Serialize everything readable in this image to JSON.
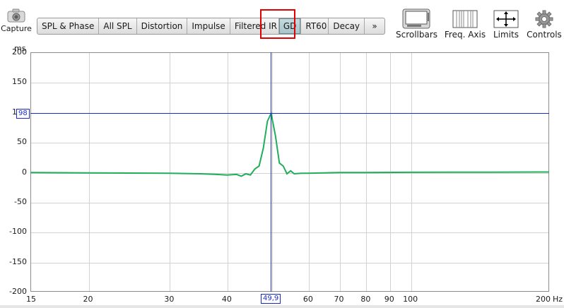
{
  "toolbar": {
    "capture_label": "Capture",
    "tabs": [
      "SPL & Phase",
      "All SPL",
      "Distortion",
      "Impulse",
      "Filtered IR",
      "GD",
      "RT60",
      "Decay"
    ],
    "more_label": "»",
    "active_tab": "GD",
    "right_tools": [
      "Scrollbars",
      "Freq. Axis",
      "Limits",
      "Controls"
    ]
  },
  "plot": {
    "y_unit": "ms",
    "x_unit": "Hz",
    "y_ticks": [
      "200",
      "150",
      "100",
      "50",
      "0",
      "-50",
      "-100",
      "-150",
      "-200"
    ],
    "x_ticks": [
      "15",
      "20",
      "30",
      "40",
      "50",
      "60",
      "70",
      "80",
      "90",
      "100",
      "200"
    ],
    "cursor_x_value": "49,9",
    "cursor_y_value": "98",
    "colors": {
      "trace": "#1fae5a",
      "cursor": "#1a2cc8",
      "highlight": "#e00000"
    }
  },
  "chart_data": {
    "type": "line",
    "x_scale": "log",
    "xlim": [
      15,
      200
    ],
    "ylim": [
      -200,
      200
    ],
    "xlabel": "Hz",
    "ylabel": "ms",
    "grid": true,
    "series": [
      {
        "x": [
          15,
          20,
          30,
          35,
          38,
          40,
          42,
          43,
          44,
          45,
          46,
          47,
          48,
          49,
          49.9,
          51,
          52,
          53,
          54,
          55,
          56,
          58,
          60,
          70,
          80,
          100,
          150,
          200
        ],
        "y": [
          -1,
          -1.5,
          -2,
          -3,
          -4,
          -5,
          -4,
          -7,
          -3,
          -5,
          5,
          10,
          40,
          85,
          98,
          60,
          15,
          10,
          -3,
          2,
          -3,
          -2,
          -2,
          -1,
          -1,
          -0.5,
          -0.2,
          0
        ]
      }
    ]
  }
}
